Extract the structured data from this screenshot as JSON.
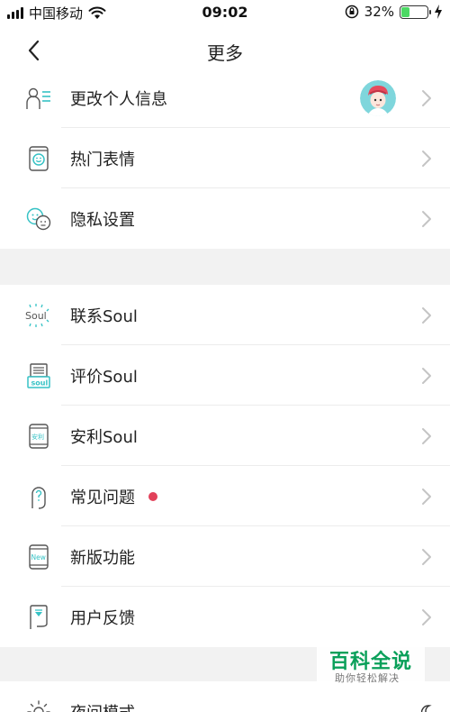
{
  "status_bar": {
    "carrier": "中国移动",
    "time": "09:02",
    "battery_percent": "32%",
    "battery_level": 0.32
  },
  "nav": {
    "title": "更多"
  },
  "group1": [
    {
      "label": "更改个人信息",
      "icon": "profile-edit-icon"
    },
    {
      "label": "热门表情",
      "icon": "phone-smiley-icon"
    },
    {
      "label": "隐私设置",
      "icon": "two-faces-icon"
    }
  ],
  "group2": [
    {
      "label": "联系Soul",
      "icon": "soul-logo-icon"
    },
    {
      "label": "评价Soul",
      "icon": "soul-box-icon"
    },
    {
      "label": "安利Soul",
      "icon": "phone-anli-icon"
    },
    {
      "label": "常见问题",
      "icon": "question-icon"
    },
    {
      "label": "新版功能",
      "icon": "new-icon"
    },
    {
      "label": "用户反馈",
      "icon": "feedback-icon"
    }
  ],
  "group3": [
    {
      "label": "夜间模式",
      "icon": "sun-icon"
    }
  ],
  "watermark": {
    "title": "百科全说",
    "subtitle": "助你轻松解决"
  },
  "colors": {
    "accent": "#36c2c5",
    "notification_dot": "#e2415a",
    "background_gap": "#f2f2f2",
    "watermark_green": "#0aa05a"
  }
}
